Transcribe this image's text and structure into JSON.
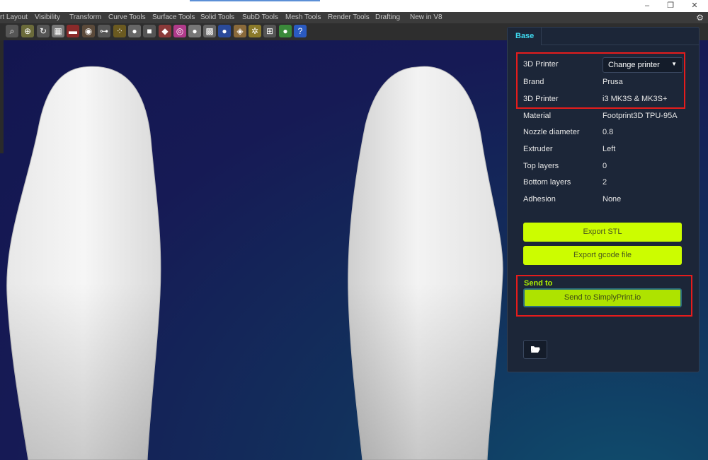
{
  "window": {
    "controls": [
      "–",
      "❐",
      "✕"
    ]
  },
  "menu_tabs": [
    "rt Layout",
    "Visibility",
    "Transform",
    "Curve Tools",
    "Surface Tools",
    "Solid Tools",
    "SubD Tools",
    "Mesh Tools",
    "Render Tools",
    "Drafting",
    "New in V8"
  ],
  "toolbar": {
    "icons": [
      "zoom-window-icon",
      "zoom-selected-icon",
      "rotate-view-icon",
      "four-viewports-icon",
      "car-icon",
      "eye-icon",
      "object-snap-icon",
      "points-icon",
      "light-bulb-icon",
      "lock-icon",
      "layer-icon",
      "color-wheel-icon",
      "sphere-icon",
      "grid-icon",
      "render-sphere-icon",
      "material-icon",
      "settings-gear-icon",
      "dimension-icon",
      "globe-icon",
      "help-icon"
    ]
  },
  "panel": {
    "tab_label": "Base",
    "printer_select": "Change printer",
    "fields": [
      {
        "label": "3D Printer",
        "value": ""
      },
      {
        "label": "Brand",
        "value": "Prusa"
      },
      {
        "label": "3D Printer",
        "value": "i3 MK3S & MK3S+"
      },
      {
        "label": "Material",
        "value": "Footprint3D TPU-95A"
      },
      {
        "label": "Nozzle diameter",
        "value": "0.8"
      },
      {
        "label": "Extruder",
        "value": "Left"
      },
      {
        "label": "Top layers",
        "value": "0"
      },
      {
        "label": "Bottom layers",
        "value": "2"
      },
      {
        "label": "Adhesion",
        "value": "None"
      }
    ],
    "export_stl": "Export STL",
    "export_gcode": "Export gcode file",
    "send_to_label": "Send to",
    "send_button": "Send to SimplyPrint.io"
  },
  "colors": {
    "accent_tab": "#3fd9ef",
    "button_lime": "#ccfd00",
    "highlight_red": "#e51c1c",
    "panel_bg": "#1c2638"
  }
}
